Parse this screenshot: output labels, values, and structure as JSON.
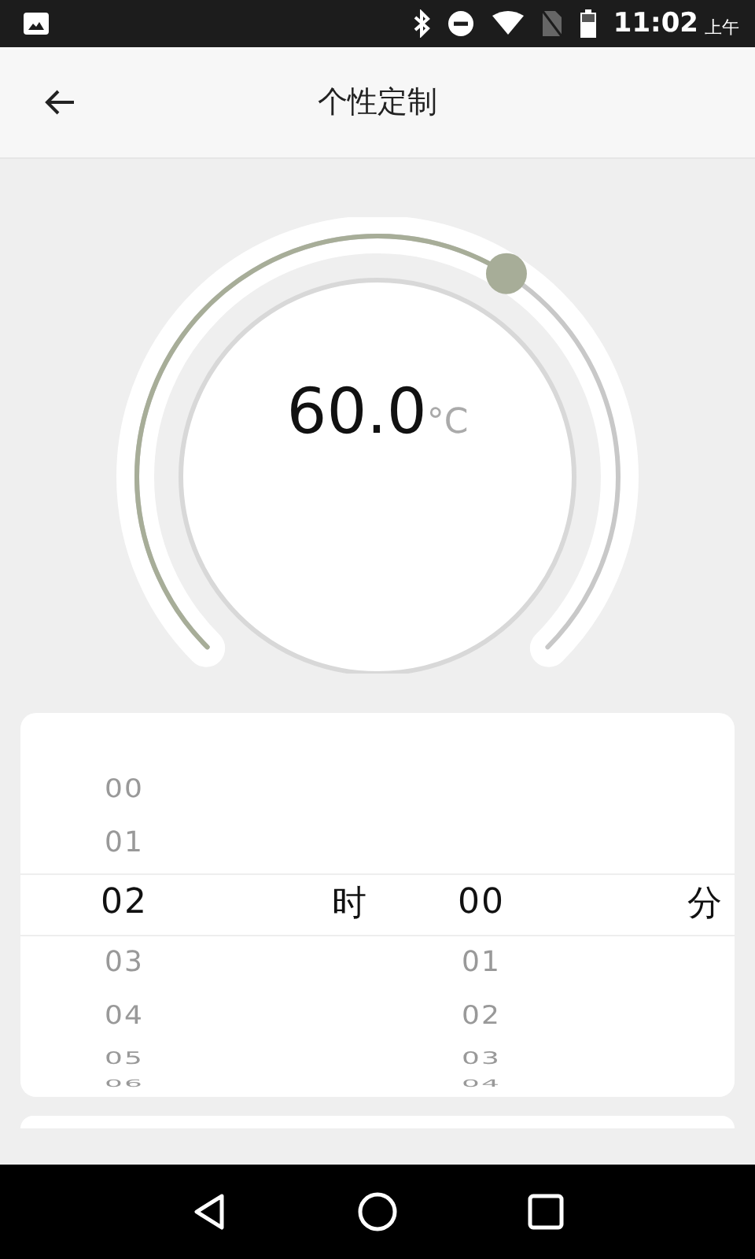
{
  "status_bar": {
    "time": "11:02",
    "period": "上午"
  },
  "header": {
    "title": "个性定制"
  },
  "dial": {
    "value": "60.0",
    "unit": "°C"
  },
  "picker": {
    "columns": [
      {
        "unit": "时",
        "items": [
          {
            "label": "00",
            "selected": false
          },
          {
            "label": "01",
            "selected": false
          },
          {
            "label": "02",
            "selected": true
          },
          {
            "label": "03",
            "selected": false
          },
          {
            "label": "04",
            "selected": false
          },
          {
            "label": "05",
            "selected": false
          },
          {
            "label": "06",
            "selected": false
          }
        ]
      },
      {
        "unit": "分",
        "items": [
          {
            "label": "00",
            "selected": true
          },
          {
            "label": "01",
            "selected": false
          },
          {
            "label": "02",
            "selected": false
          },
          {
            "label": "03",
            "selected": false
          },
          {
            "label": "04",
            "selected": false
          }
        ]
      }
    ]
  }
}
